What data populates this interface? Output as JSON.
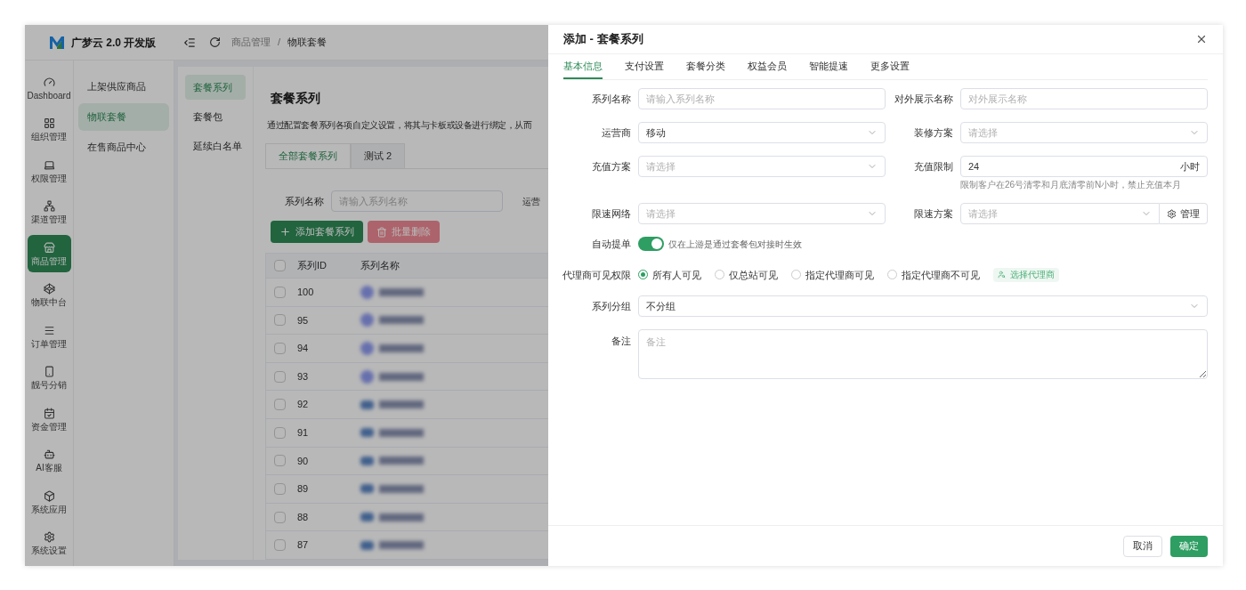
{
  "app": {
    "logo_text": "广梦云 2.0 开发版",
    "rail": [
      {
        "label": "Dashboard",
        "selected": false
      },
      {
        "label": "组织管理",
        "selected": false
      },
      {
        "label": "权限管理",
        "selected": false
      },
      {
        "label": "渠道管理",
        "selected": false
      },
      {
        "label": "商品管理",
        "selected": true
      },
      {
        "label": "物联中台",
        "selected": false
      },
      {
        "label": "订单管理",
        "selected": false
      },
      {
        "label": "靓号分销",
        "selected": false
      },
      {
        "label": "资金管理",
        "selected": false
      },
      {
        "label": "AI客服",
        "selected": false
      },
      {
        "label": "系统应用",
        "selected": false
      },
      {
        "label": "系统设置",
        "selected": false
      }
    ],
    "submenu": [
      {
        "label": "上架供应商品",
        "selected": false
      },
      {
        "label": "物联套餐",
        "selected": true
      },
      {
        "label": "在售商品中心",
        "selected": false
      }
    ],
    "breadcrumb": [
      "商品管理",
      "/",
      "物联套餐"
    ],
    "section_menu": [
      {
        "label": "套餐系列",
        "selected": true
      },
      {
        "label": "套餐包",
        "selected": false
      },
      {
        "label": "延续白名单",
        "selected": false
      }
    ],
    "page_title": "套餐系列",
    "description": "通过配置套餐系列各项自定义设置，将其与卡板或设备进行绑定，从而",
    "tabs": [
      {
        "label": "全部套餐系列",
        "selected": true
      },
      {
        "label": "测试 2",
        "selected": false
      }
    ],
    "filter": {
      "label": "系列名称",
      "placeholder": "请输入系列名称",
      "next_label": "运营"
    },
    "add_button": "添加套餐系列",
    "delete_button": "批量删除",
    "table": {
      "columns": [
        "系列ID",
        "系列名称"
      ],
      "all_checked": false,
      "rows": [
        {
          "id": "100",
          "kind": "circle",
          "checked": false
        },
        {
          "id": "95",
          "kind": "circle",
          "checked": false
        },
        {
          "id": "94",
          "kind": "circle",
          "checked": false
        },
        {
          "id": "93",
          "kind": "circle",
          "checked": false
        },
        {
          "id": "92",
          "kind": "square",
          "checked": false
        },
        {
          "id": "91",
          "kind": "square",
          "checked": false
        },
        {
          "id": "90",
          "kind": "square",
          "checked": false
        },
        {
          "id": "89",
          "kind": "square",
          "checked": false
        },
        {
          "id": "88",
          "kind": "square",
          "checked": false
        },
        {
          "id": "87",
          "kind": "square",
          "checked": false
        }
      ]
    }
  },
  "drawer": {
    "title": "添加 - 套餐系列",
    "tabs": [
      {
        "label": "基本信息",
        "selected": true
      },
      {
        "label": "支付设置",
        "selected": false
      },
      {
        "label": "套餐分类",
        "selected": false
      },
      {
        "label": "权益会员",
        "selected": false
      },
      {
        "label": "智能提速",
        "selected": false
      },
      {
        "label": "更多设置",
        "selected": false
      }
    ],
    "fields": [
      {
        "label": "系列名称",
        "kind": "input",
        "placeholder": "请输入系列名称"
      },
      {
        "label": "对外展示名称",
        "kind": "input",
        "placeholder": "对外展示名称"
      },
      {
        "label": "运营商",
        "kind": "select",
        "value": "移动"
      },
      {
        "label": "装修方案",
        "kind": "select",
        "placeholder": "请选择"
      },
      {
        "label": "充值方案",
        "kind": "select",
        "placeholder": "请选择"
      },
      {
        "label": "充值限制",
        "kind": "input",
        "value": "24",
        "suffix": "小时",
        "help": "限制客户在26号清零和月底清零前N小时，禁止充值本月"
      },
      {
        "label": "限速网络",
        "kind": "select",
        "placeholder": "请选择"
      },
      {
        "label": "限速方案",
        "kind": "select",
        "placeholder": "请选择",
        "action": "管理"
      }
    ],
    "auto_order": {
      "label": "自动提单",
      "on": true,
      "hint": "仅在上游是通过套餐包对接时生效"
    },
    "visibility": {
      "label": "代理商可见权限",
      "options": [
        {
          "label": "所有人可见",
          "selected": true
        },
        {
          "label": "仅总站可见",
          "selected": false
        },
        {
          "label": "指定代理商可见",
          "selected": false
        },
        {
          "label": "指定代理商不可见",
          "selected": false
        }
      ],
      "action": "选择代理商"
    },
    "group": {
      "label": "系列分组",
      "value": "不分组"
    },
    "remark": {
      "label": "备注",
      "placeholder": "备注"
    },
    "cancel": "取消",
    "confirm": "确定"
  }
}
